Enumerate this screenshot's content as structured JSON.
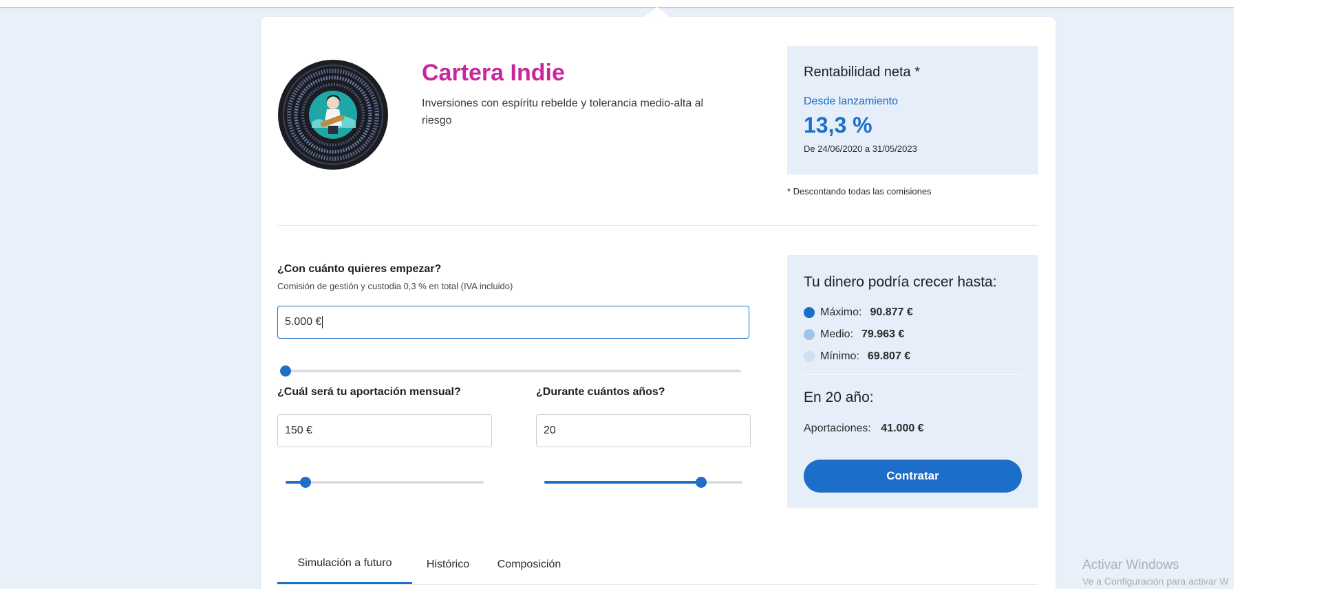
{
  "portfolio": {
    "title": "Cartera Indie",
    "description": "Inversiones con espíritu rebelde y tolerancia medio-alta al riesgo",
    "icon": "vinyl-record-guitarist-icon"
  },
  "returns": {
    "title": "Rentabilidad neta *",
    "subtitle": "Desde lanzamiento",
    "value": "13,3 %",
    "date_range": "De 24/06/2020 a 31/05/2023",
    "footnote": "* Descontando todas las comisiones"
  },
  "initial": {
    "question": "¿Con cuánto quieres empezar?",
    "hint": "Comisión de gestión y custodia 0,3 % en total (IVA incluido)",
    "value": "5.000 €",
    "slider_fraction": 0.0
  },
  "monthly": {
    "question": "¿Cuál será tu aportación mensual?",
    "value": "150 €",
    "slider_fraction": 0.1
  },
  "years": {
    "question": "¿Durante cuántos años?",
    "value": "20",
    "slider_fraction": 0.79
  },
  "simulation": {
    "title": "Tu dinero podría crecer hasta:",
    "max_label": "Máximo:",
    "max_value": "90.877 €",
    "mid_label": "Medio:",
    "mid_value": "79.963 €",
    "min_label": "Mínimo:",
    "min_value": "69.807 €",
    "years_title": "En 20 año:",
    "contrib_label": "Aportaciones:",
    "contrib_value": "41.000 €",
    "button_label": "Contratar"
  },
  "tabs": [
    {
      "label": "Simulación a futuro",
      "active": true
    },
    {
      "label": "Histórico",
      "active": false
    },
    {
      "label": "Composición",
      "active": false
    }
  ],
  "watermark": {
    "line1": "Activar Windows",
    "line2": "Ve a Configuración para activar W"
  },
  "colors": {
    "brand_blue": "#1c6ec9",
    "title_magenta": "#c8289b",
    "panel_bg": "#e5eef9",
    "dot_max": "#1c6ec9",
    "dot_mid": "#a3c2ea",
    "dot_min": "#cfdff4"
  }
}
